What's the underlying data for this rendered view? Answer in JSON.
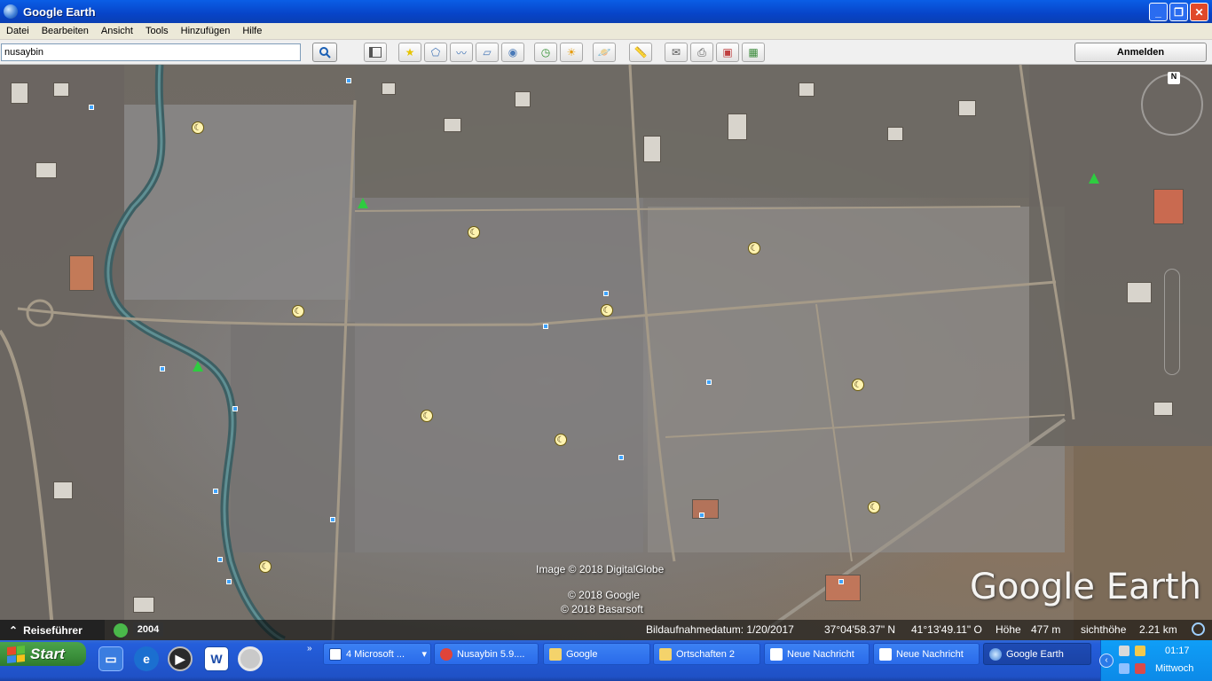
{
  "window": {
    "title": "Google Earth",
    "minimize": "_",
    "maximize": "❐",
    "close": "✕"
  },
  "menu": [
    "Datei",
    "Bearbeiten",
    "Ansicht",
    "Tools",
    "Hinzufügen",
    "Hilfe"
  ],
  "toolbar": {
    "search_value": "nusaybin",
    "login_label": "Anmelden"
  },
  "map": {
    "credits": [
      "Image © 2018 DigitalGlobe",
      "© 2018 Google",
      "© 2018 Basarsoft"
    ],
    "brand": "Google Earth",
    "compass_n": "N"
  },
  "statusbar": {
    "tour_guide": "Reiseführer",
    "year": "2004",
    "imagery_date": "Bildaufnahmedatum: 1/20/2017",
    "lat": "37°04'58.37\" N",
    "lon": "41°13'49.11\" O",
    "elevation_label": "Höhe",
    "elevation_value": "477 m",
    "eye_alt_label": "sichthöhe",
    "eye_alt_value": "2.21 km"
  },
  "taskbar": {
    "start_label": "Start",
    "tasks": [
      {
        "label": "4 Microsoft ...",
        "icon": "word-icon"
      },
      {
        "label": "Nusaybin 5.9....",
        "icon": "chrome-icon"
      },
      {
        "label": "Google",
        "icon": "folder-icon"
      },
      {
        "label": "Ortschaften 2",
        "icon": "folder-icon"
      },
      {
        "label": "Neue Nachricht",
        "icon": "mail-icon"
      },
      {
        "label": "Neue Nachricht",
        "icon": "mail-icon"
      },
      {
        "label": "Google Earth",
        "icon": "earth-icon"
      }
    ],
    "clock": "01:17",
    "day": "Mittwoch"
  }
}
